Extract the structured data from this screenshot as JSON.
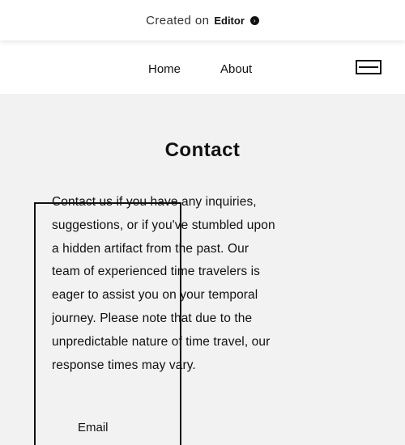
{
  "banner": {
    "created_on": "Created on",
    "brand": "Editor",
    "chevron": "›"
  },
  "nav": {
    "home": "Home",
    "about": "About",
    "menu_icon": "menu-icon"
  },
  "main": {
    "title": "Contact",
    "paragraph": "Contact us if you have any inquiries, suggestions, or if you've stumbled upon a hidden artifact from the past. Our team of experienced time travelers is eager to assist you on your temporal journey. Please note that due to the unpredictable nature of time travel, our response times may vary.",
    "email_label": "Email"
  }
}
